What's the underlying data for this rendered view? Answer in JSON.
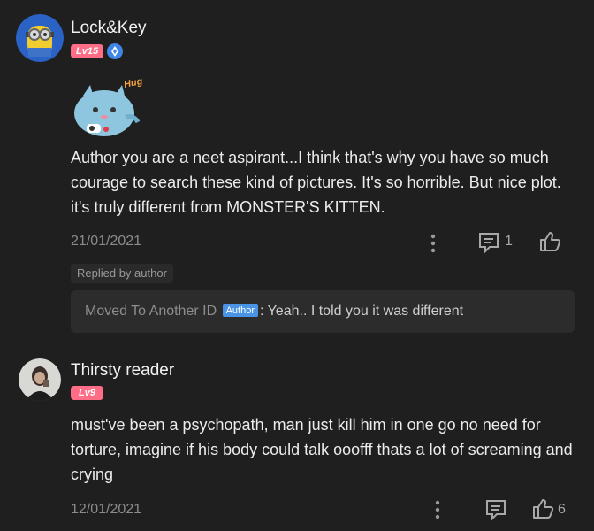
{
  "comments": [
    {
      "username": "Lock&Key",
      "level": "Lv15",
      "text": "Author you are a neet aspirant...I think that's why you have so much courage to search these kind of pictures.  It's so horrible. But nice plot. it's truly different from MONSTER'S KITTEN.",
      "date": "21/01/2021",
      "reply_count": "1",
      "replied_label": "Replied by author",
      "reply": {
        "name": "Moved To Another ID",
        "badge": "Author",
        "text": ": Yeah.. I told you it was different"
      },
      "sticker_text": "Hug"
    },
    {
      "username": "Thirsty reader",
      "level": "Lv9",
      "text": "must've been a psychopath, man just kill him in one go no need for torture, imagine if his body could talk ooofff thats a lot of screaming and crying",
      "date": "12/01/2021",
      "like_count": "6"
    }
  ],
  "colors": {
    "background": "#1f1f1f",
    "level_badge": "#ff6e86",
    "author_badge": "#4a94e6"
  }
}
